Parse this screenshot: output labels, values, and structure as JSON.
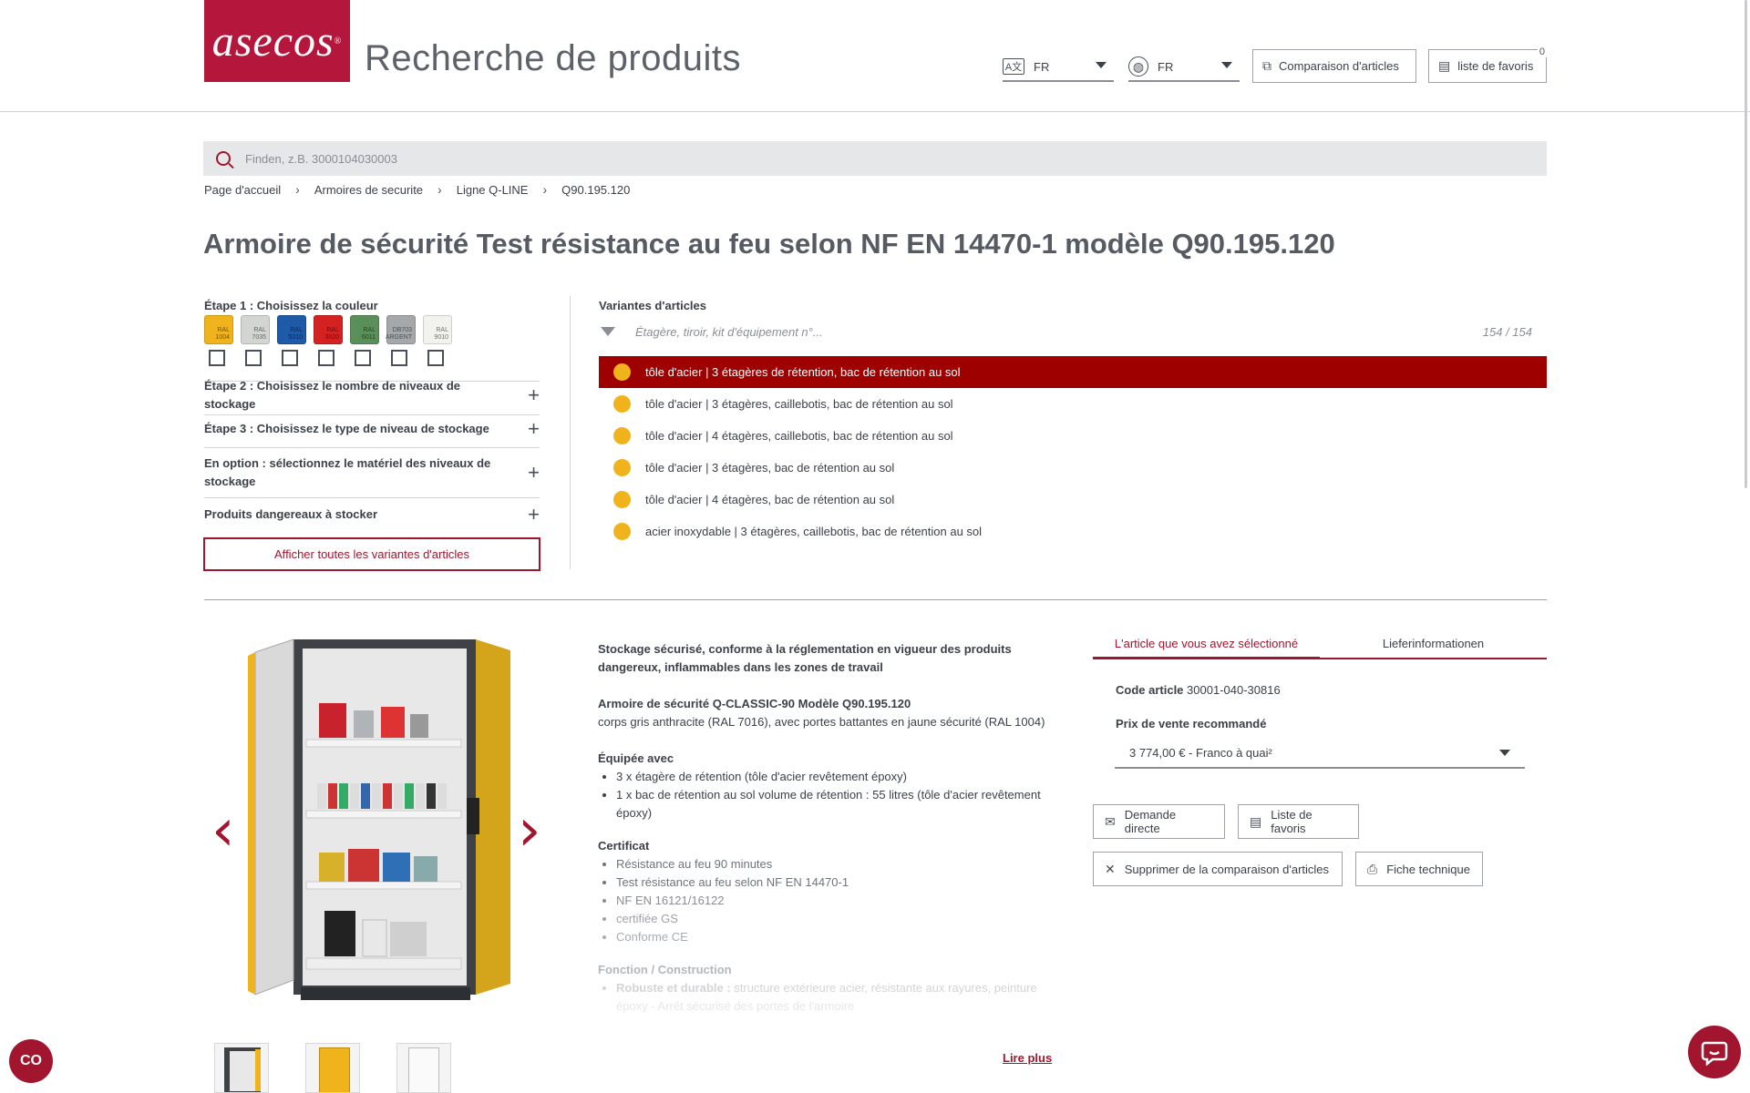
{
  "header": {
    "logo_text": "asecos",
    "title": "Recherche de produits",
    "language_select": {
      "icon": "translate-icon",
      "value": "FR"
    },
    "country_select": {
      "icon": "globe-icon",
      "value": "FR"
    },
    "compare_button": "Comparaison d'articles",
    "favorites_button": "liste de favoris",
    "favorites_count": "0"
  },
  "search": {
    "placeholder": "Finden, z.B. 3000104030003"
  },
  "breadcrumb": [
    "Page d'accueil",
    "Armoires de securite",
    "Ligne Q-LINE",
    "Q90.195.120"
  ],
  "page_title": "Armoire de sécurité Test résistance au feu selon NF EN 14470-1 modèle Q90.195.120",
  "filters": {
    "step1_label": "Étape 1 : Choisissez la couleur",
    "colors": [
      {
        "code": "RAL",
        "num": "1004",
        "hex": "#f1b31c"
      },
      {
        "code": "RAL",
        "num": "7035",
        "hex": "#d3d5d3"
      },
      {
        "code": "RAL",
        "num": "5010",
        "hex": "#1e5aa8"
      },
      {
        "code": "RAL",
        "num": "3020",
        "hex": "#d42222"
      },
      {
        "code": "RAL",
        "num": "6011",
        "hex": "#5b8f5a"
      },
      {
        "code": "DB703",
        "num": "ARGENT",
        "hex": "#a5a8ab"
      },
      {
        "code": "RAL",
        "num": "9010",
        "hex": "#f2f2ef"
      }
    ],
    "step2_label": "Étape 2 : Choisissez le nombre de niveaux de stockage",
    "step3_label": "Étape 3 : Choisissez le type de niveau de stockage",
    "option_label": "En option : sélectionnez le matériel des niveaux de stockage",
    "hazard_label": "Produits dangereaux à stocker",
    "show_all_button": "Afficher toutes les variantes d'articles"
  },
  "variants": {
    "title": "Variantes d'articles",
    "filter_placeholder": "Étagère, tiroir, kit d'équipement n°...",
    "count": "154 / 154",
    "items": [
      "tôle d'acier | 3 étagères de rétention, bac de rétention au sol",
      "tôle d'acier | 3 étagères, caillebotis, bac de rétention au sol",
      "tôle d'acier | 4 étagères, caillebotis, bac de rétention au sol",
      "tôle d'acier | 3 étagères, bac de rétention au sol",
      "tôle d'acier | 4 étagères, bac de rétention au sol",
      "acier inoxydable | 3 étagères, caillebotis, bac de rétention au sol"
    ],
    "selected_index": 0
  },
  "description": {
    "intro": "Stockage sécurisé, conforme à la réglementation en vigueur des produits dangereux, inflammables dans les zones de travail",
    "model_title": "Armoire de sécurité Q-CLASSIC-90 Modèle Q90.195.120",
    "model_text": "corps gris anthracite (RAL 7016), avec portes battantes en jaune sécurité (RAL 1004)",
    "equipped_title": "Équipée avec",
    "equipped_items": [
      "3 x étagère de rétention (tôle d'acier revêtement époxy)",
      "1 x bac de rétention au sol volume de rétention : 55 litres (tôle d'acier revêtement époxy)"
    ],
    "cert_title": "Certificat",
    "cert_items": [
      "Résistance au feu 90 minutes",
      "Test résistance au feu selon NF EN 14470-1",
      "NF EN 16121/16122",
      "certifiée GS",
      "Conforme CE"
    ],
    "function_title": "Fonction / Construction",
    "function_bold": "Robuste et durable :",
    "function_text": " structure extérieure acier, résistante aux rayures, peinture",
    "function_text2": "époxy - Arrêt sécurisé des portes de l'armoire",
    "read_more": "Lire plus"
  },
  "product_panel": {
    "tab_selected": "L'article que vous avez sélectionné",
    "tab_delivery": "Lieferinformationen",
    "article_code_label": "Code article",
    "article_code": "30001-040-30816",
    "price_label": "Prix de vente recommandé",
    "price_value": "3 774,00 € - Franco à quai²",
    "buttons": {
      "inquiry": "Demande directe",
      "favorites": "Liste de favoris",
      "remove_compare": "Supprimer de la comparaison d'articles",
      "datasheet": "Fiche technique"
    }
  },
  "colors": {
    "brand": "#a1162e",
    "selected_row": "#9e0000",
    "variant_dot": "#f1b31c"
  }
}
